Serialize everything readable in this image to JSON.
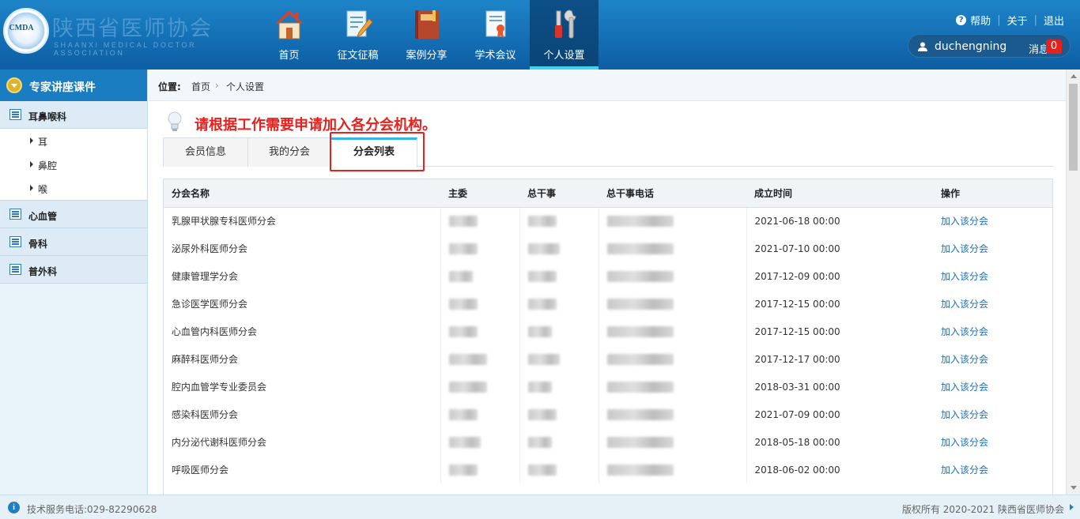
{
  "header": {
    "logo": {
      "seal_text": "CMDA",
      "name_cn": "陕西省医师协会",
      "name_en": "SHAANXI MEDICAL DOCTOR ASSOCIATION"
    },
    "nav": [
      {
        "label": "首页",
        "icon": "home-icon"
      },
      {
        "label": "征文征稿",
        "icon": "document-edit-icon"
      },
      {
        "label": "案例分享",
        "icon": "book-icon"
      },
      {
        "label": "学术会议",
        "icon": "certificate-icon"
      },
      {
        "label": "个人设置",
        "icon": "tools-icon",
        "active": true
      }
    ],
    "links": {
      "help": "帮助",
      "about": "关于",
      "logout": "退出"
    },
    "user": {
      "name": "duchengning",
      "message_label": "消息",
      "message_count": "0"
    }
  },
  "sidebar": {
    "title": "专家讲座课件",
    "groups": [
      {
        "label": "耳鼻喉科",
        "children": [
          "耳",
          "鼻腔",
          "喉"
        ]
      },
      {
        "label": "心血管",
        "children": []
      },
      {
        "label": "骨科",
        "children": []
      },
      {
        "label": "普外科",
        "children": []
      }
    ]
  },
  "breadcrumb": {
    "label": "位置:",
    "home": "首页",
    "separator": "›",
    "current": "个人设置"
  },
  "notice": "请根据工作需要申请加入各分会机构。",
  "tabs": [
    {
      "label": "会员信息"
    },
    {
      "label": "我的分会"
    },
    {
      "label": "分会列表",
      "active": true
    }
  ],
  "table": {
    "columns": [
      "分会名称",
      "主委",
      "总干事",
      "总干事电话",
      "成立时间",
      "操作"
    ],
    "action_label": "加入该分会",
    "rows": [
      {
        "name": "乳腺甲状腺专科医师分会",
        "date": "2021-06-18 00:00"
      },
      {
        "name": "泌尿外科医师分会",
        "date": "2021-07-10 00:00"
      },
      {
        "name": "健康管理学分会",
        "date": "2017-12-09 00:00"
      },
      {
        "name": "急诊医学医师分会",
        "date": "2017-12-15 00:00"
      },
      {
        "name": "心血管内科医师分会",
        "date": "2017-12-15 00:00"
      },
      {
        "name": "麻醉科医师分会",
        "date": "2017-12-17 00:00"
      },
      {
        "name": "腔内血管学专业委员会",
        "date": "2018-03-31 00:00"
      },
      {
        "name": "感染科医师分会",
        "date": "2021-07-09 00:00"
      },
      {
        "name": "内分泌代谢科医师分会",
        "date": "2018-05-18 00:00"
      },
      {
        "name": "呼吸医师分会",
        "date": "2018-06-02 00:00"
      }
    ]
  },
  "footer": {
    "service": "技术服务电话:029-82290628",
    "copyright": "版权所有 2020-2021 陕西省医师协会"
  }
}
